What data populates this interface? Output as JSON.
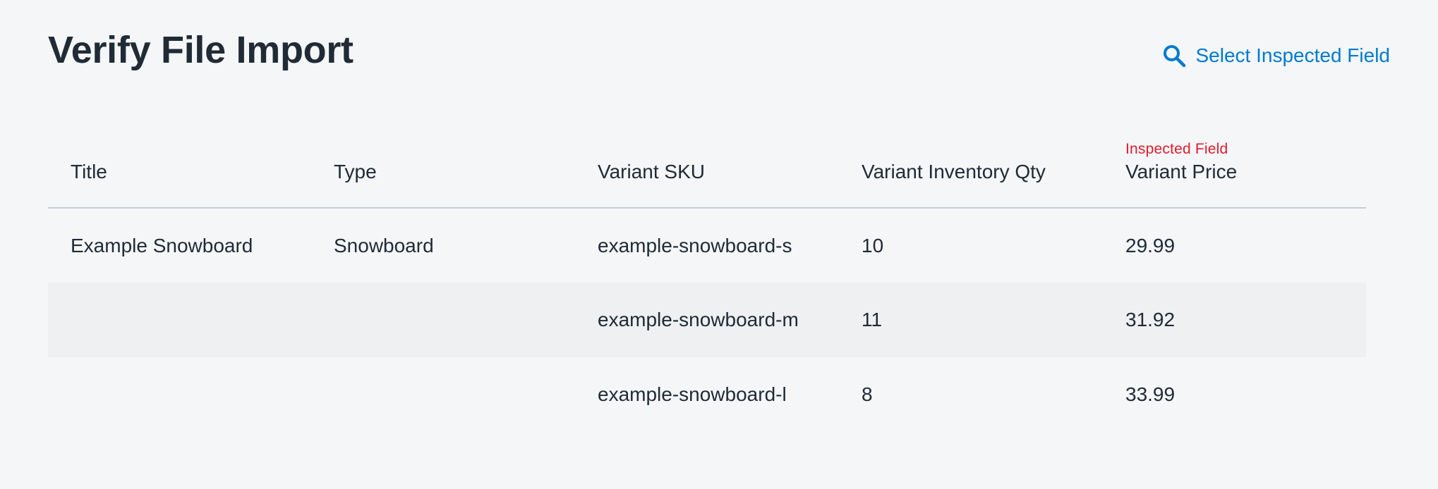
{
  "header": {
    "title": "Verify File Import",
    "select_link_label": "Select Inspected Field",
    "select_link_icon": "search-icon"
  },
  "colors": {
    "accent": "#007ace",
    "inspected_tag": "#de1c2c",
    "background": "#f4f6f8",
    "alt_row": "#eef0f2",
    "text": "#212b36"
  },
  "table": {
    "inspected_tag": "Inspected Field",
    "columns": [
      "Title",
      "Type",
      "Variant SKU",
      "Variant Inventory Qty",
      "Variant Price"
    ],
    "rows": [
      [
        "Example Snowboard",
        "Snowboard",
        "example-snowboard-s",
        "10",
        "29.99"
      ],
      [
        "",
        "",
        "example-snowboard-m",
        "11",
        "31.92"
      ],
      [
        "",
        "",
        "example-snowboard-l",
        "8",
        "33.99"
      ]
    ]
  }
}
